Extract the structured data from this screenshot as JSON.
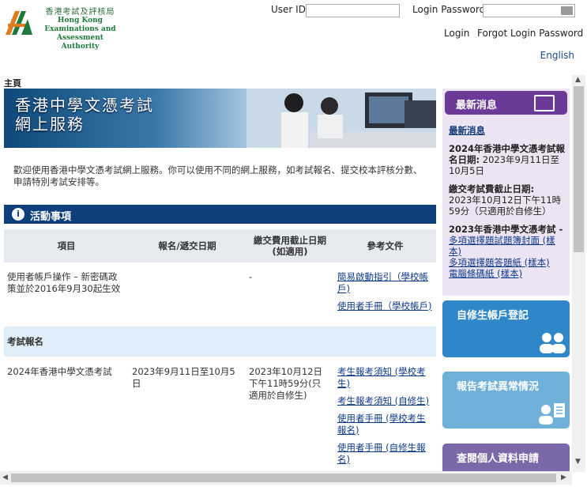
{
  "header": {
    "org_name_cn": "香港考試及評核局",
    "org_name_en_1": "Hong Kong",
    "org_name_en_2": "Examinations and",
    "org_name_en_3": "Assessment Authority",
    "user_id_label": "User ID",
    "user_id_value": "",
    "password_label": "Login Password",
    "password_value": "",
    "login_link": "Login",
    "forgot_link": "Forgot Login Password",
    "language_link": "English"
  },
  "breadcrumb": "主頁",
  "banner": {
    "line1": "香港中學文憑考試",
    "line2": "網上服務"
  },
  "welcome_text": "歡迎使用香港中學文憑考試網上服務。你可以使用不同的網上服務，如考試報名、提交校本評核分數、申請特別考試安排等。",
  "activities": {
    "title": "活動事項",
    "columns": [
      "項目",
      "報名/遞交日期",
      "繳交費用截止日期\n(如適用)",
      "參考文件"
    ],
    "rows": [
      {
        "item": "使用者帳戶操作 – 新密碼政策並於2016年9月30起生效",
        "dates": "",
        "deadline": "-",
        "docs": [
          "簡易啟動指引（學校帳戶)",
          "使用者手冊（學校帳戶)"
        ]
      }
    ],
    "subsection": "考試報名",
    "rows2": [
      {
        "item": "2024年香港中學文憑考試",
        "dates": "2023年9月11日至10月5日",
        "deadline": "2023年10月12日下午11時59分(只適用於自修生)",
        "docs": [
          "考生報考須知 (學校考生)",
          "考生報考須知 (自修生)",
          "使用者手冊 (學校考生報名)",
          "使用者手冊 (自修生報名)"
        ]
      }
    ]
  },
  "sidebar": {
    "news_title": "最新消息",
    "news_heading": "最新消息",
    "news_items": [
      {
        "title": "2024年香港中學文憑考試報名日期:",
        "body": "2023年9月11日至10月5日"
      },
      {
        "title": "繳交考試費截止日期:",
        "body": "2023年10月12日下午11時59分（只適用於自修生）"
      }
    ],
    "news_item3_title": "2023年香港中學文憑考試 -",
    "news_item3_links": [
      "多項選擇題試題簿封面 (樣本)",
      "多項選擇題答題紙 (樣本)",
      "電腦條碼紙 (樣本)"
    ],
    "tiles": [
      {
        "label": "自修生帳戶登記",
        "color": "#2f86c9"
      },
      {
        "label": "報告考試異常情況",
        "color": "#6fb0d8"
      },
      {
        "label": "查閱個人資料申請",
        "color": "#7c68a8"
      }
    ]
  }
}
